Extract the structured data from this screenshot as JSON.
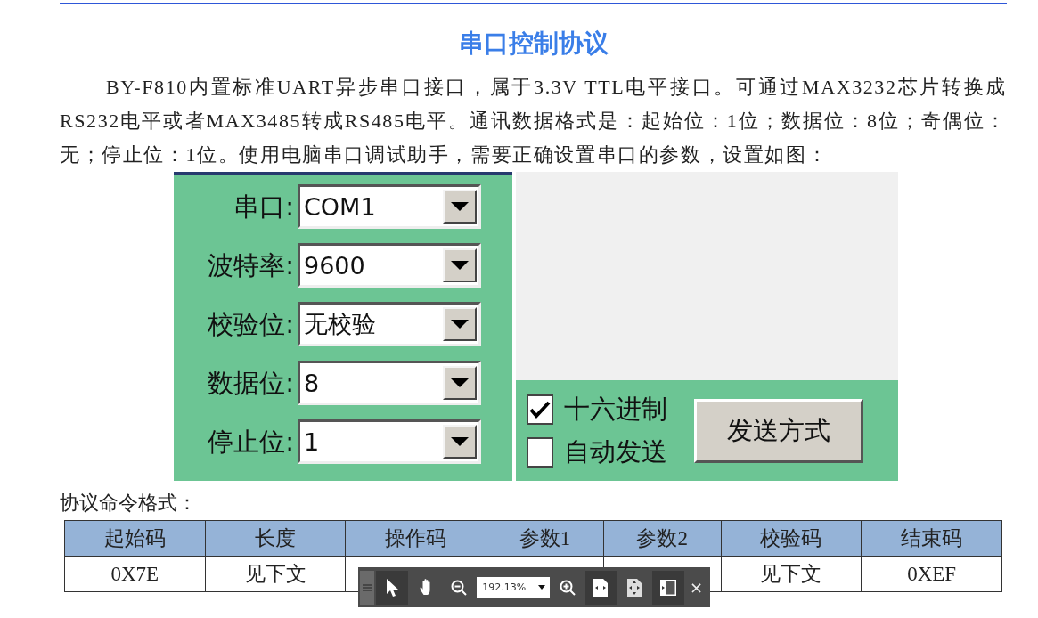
{
  "document": {
    "title": "串口控制协议",
    "paragraph": "BY-F810内置标准UART异步串口接口，属于3.3V TTL电平接口。可通过MAX3232芯片转换成RS232电平或者MAX3485转成RS485电平。通讯数据格式是：起始位：1位；数据位：8位；奇偶位：无；停止位：1位。使用电脑串口调试助手，需要正确设置串口的参数，设置如图：",
    "figure": {
      "fields": [
        {
          "label": "串口:",
          "value": "COM1"
        },
        {
          "label": "波特率:",
          "value": "9600"
        },
        {
          "label": "校验位:",
          "value": "无校验"
        },
        {
          "label": "数据位:",
          "value": "8"
        },
        {
          "label": "停止位:",
          "value": "1"
        }
      ],
      "checkboxes": [
        {
          "label": "十六进制",
          "checked": true
        },
        {
          "label": "自动发送",
          "checked": false
        }
      ],
      "button": "发送方式"
    },
    "table_caption": "协议命令格式：",
    "table": {
      "columns": [
        "起始码",
        "长度",
        "操作码",
        "参数1",
        "参数2",
        "校验码",
        "结束码"
      ],
      "rows": [
        [
          "0X7E",
          "见下文",
          null,
          null,
          null,
          "见下文",
          "0XEF"
        ]
      ]
    }
  },
  "viewer_toolbar": {
    "tools": [
      {
        "kind": "pointer",
        "selected": true
      },
      {
        "kind": "hand",
        "selected": false
      },
      {
        "kind": "zoom-out",
        "selected": false
      },
      {
        "kind": "zoom-field",
        "selected": false
      },
      {
        "kind": "zoom-in",
        "selected": false
      },
      {
        "kind": "fit-width",
        "selected": true
      },
      {
        "kind": "fit-page",
        "selected": false
      },
      {
        "kind": "sidebar",
        "selected": true
      }
    ],
    "zoom": "192.13%",
    "close": "×"
  }
}
